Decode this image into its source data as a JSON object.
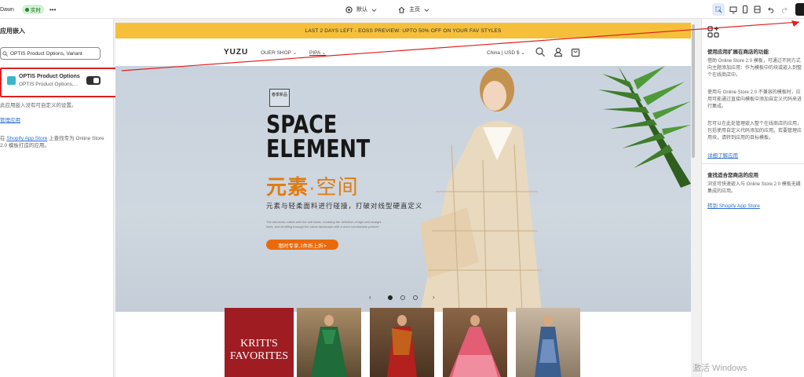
{
  "topbar": {
    "theme_name": "Dawn",
    "live_badge": "实时",
    "more": "•••",
    "template_select": "默认",
    "page_select": "主页"
  },
  "left_panel": {
    "title": "应用嵌入",
    "search_value": "OPTIS Product Options, Variant",
    "app_name": "OPTIS Product Options",
    "app_subtitle": "OPTIS Product Options,...",
    "app_enabled": true,
    "no_settings_text": "此应用嵌入没有可自定义的设置。",
    "manage_link": "管理应用",
    "store_prefix": "在",
    "store_link": "Shopify App Store",
    "store_suffix": "上查找专为 Online Store",
    "store_line2": "2.0 模板打造的应用。"
  },
  "store": {
    "announcement": "LAST 2 DAYS LEFT - EOSS PREVIEW: UPTO 50% OFF ON YOUR FAV STYLES",
    "logo": "YUZU",
    "nav": [
      "OUER SHOP",
      "PIPA"
    ],
    "currency": "China | USD $",
    "hero": {
      "stamp": "春季新品",
      "title_line1": "SPACE",
      "title_line2": "ELEMENT",
      "cn_bold": "元素",
      "cn_light": "·空间",
      "subtitle": "元素与轻柔面料进行碰撞，打破对线型硬直定义",
      "fine_print": "The elements collide with the soft fabric, breaking the definition of rigid and straight lines, and shuttling through the urban landscape with a more comfortable posture",
      "cta": "限时专享,1件折上折>"
    },
    "slider": {
      "prev": "‹",
      "next": "›",
      "count": 3,
      "active": 0
    },
    "collection_title": "KRITI'S FAVORITES",
    "products": [
      "green-dress",
      "red-dress",
      "pink-lehenga",
      "blue-kurta"
    ]
  },
  "right_panel": {
    "heading": "使用应用扩展在商店的功能",
    "p1": "借助 Online Store 2.0 模板，可通过不同方式向主题添加应用：作为模板中的块或嵌入到整个在线商店中。",
    "p2": "使用与 Online Store 2.0 不兼容的模板时，应用可能通过直接向模板中添加自定义代码来进行集成。",
    "p3": "您可以在此处管理嵌入整个在线商店的应用，包括使用自定义代码添加的应用。若要管理应用块，请转到应用的目标模板。",
    "link1": "详细了解应用",
    "heading2": "查找适合您商店的应用",
    "p4": "浏览可快速嵌入与 Online Store 2.0 模板无缝集成的应用。",
    "link2": "转到 Shopify App Store"
  },
  "watermark": "激活 Windows",
  "colors": {
    "announcement": "#f5bf3a",
    "cta": "#e96a0b",
    "accent_orange": "#e07b12",
    "annotation_red": "#e02020",
    "link": "#2c6ecb"
  }
}
